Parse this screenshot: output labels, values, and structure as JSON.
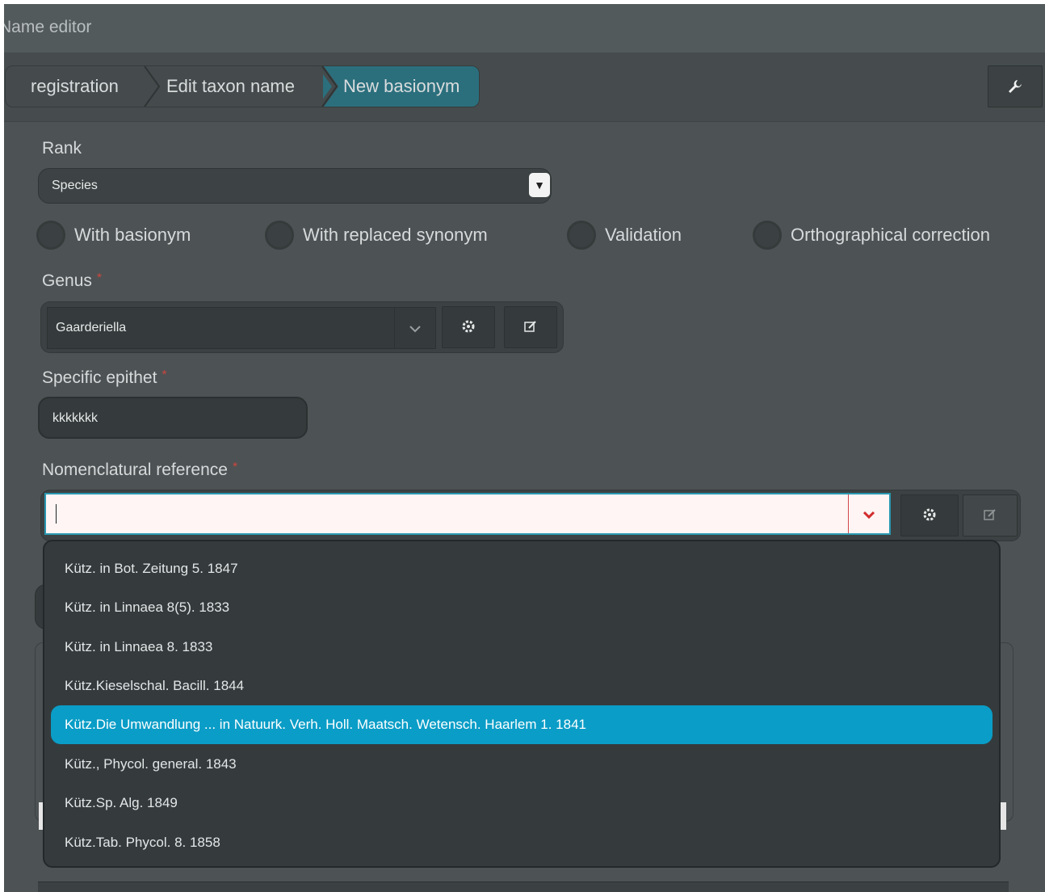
{
  "window": {
    "title": "Name editor"
  },
  "breadcrumb": {
    "items": [
      {
        "label": "registration"
      },
      {
        "label": "Edit taxon name"
      },
      {
        "label": "New basionym"
      }
    ]
  },
  "toolbar": {
    "settings_icon": "wrench-icon"
  },
  "form": {
    "rank": {
      "label": "Rank",
      "value": "Species"
    },
    "checkboxes": [
      {
        "label": "With basionym",
        "checked": false
      },
      {
        "label": "With replaced synonym",
        "checked": false
      },
      {
        "label": "Validation",
        "checked": false
      },
      {
        "label": "Orthographical correction",
        "checked": false
      }
    ],
    "genus": {
      "label": "Genus",
      "required_mark": "*",
      "value": "Gaarderiella"
    },
    "specific_epithet": {
      "label": "Specific epithet",
      "required_mark": "*",
      "value": "kkkkkkk"
    },
    "nomenclatural_reference": {
      "label": "Nomenclatural reference",
      "required_mark": "*",
      "value": "",
      "options": [
        "Kütz. in Bot. Zeitung 5. 1847",
        "Kütz. in Linnaea 8(5). 1833",
        "Kütz. in Linnaea 8. 1833",
        "Kütz.Kieselschal. Bacill. 1844",
        "Kütz.Die Umwandlung ... in Natuurk. Verh. Holl. Maatsch. Wetensch. Haarlem 1. 1841",
        "Kütz., Phycol. general. 1843",
        "Kütz.Sp. Alg. 1849",
        "Kütz.Tab. Phycol. 8. 1858"
      ],
      "highlighted_index": 4
    }
  },
  "colors": {
    "accent": "#0a9dc7",
    "breadcrumb_active": "#2b6f7d",
    "required": "#c9473f",
    "error_border": "#d04848"
  }
}
